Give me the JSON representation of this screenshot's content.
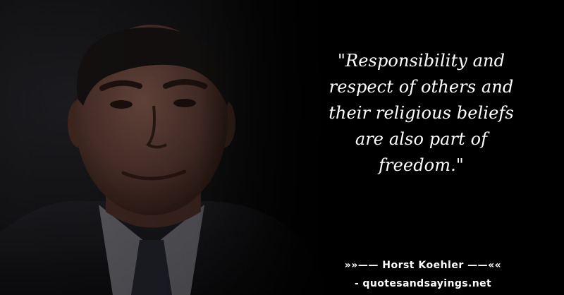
{
  "quote": {
    "text": "\"Responsibility and respect of others and their religious beliefs are also part of freedom.\"",
    "author_line": "»»—— Horst Koehler ——««",
    "source": "- quotesandsayings.net"
  },
  "portrait": {
    "icon": "person-portrait-image"
  },
  "colors": {
    "background": "#000000",
    "text": "#ffffff"
  }
}
